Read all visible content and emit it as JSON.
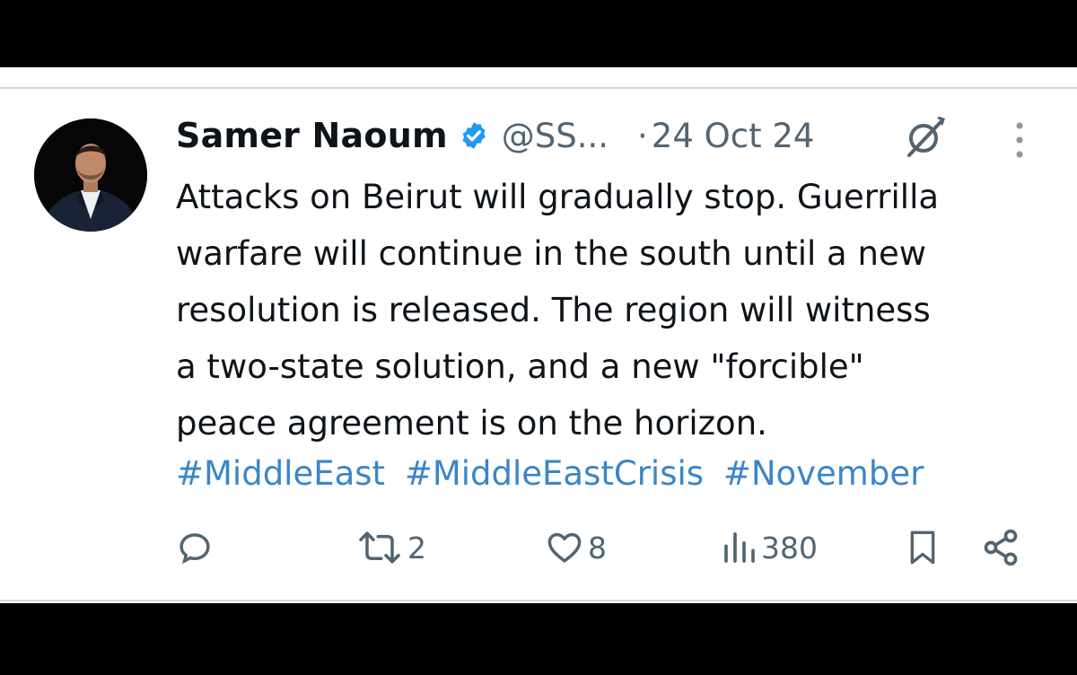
{
  "tweet": {
    "author_name": "Samer Naoum",
    "handle": "@SS...",
    "separator": "·",
    "date": "24 Oct 24",
    "text_lines": [
      "Attacks on Beirut will gradually stop. Guerrilla",
      "warfare will continue in the south until a new",
      "resolution is released. The region will witness",
      "a two-state solution, and a new \"forcible\"",
      "peace agreement is on the horizon."
    ],
    "hashtags": [
      "#MiddleEast",
      "#MiddleEastCrisis",
      "#November"
    ]
  },
  "actions": {
    "reply_count": "",
    "retweet_count": "2",
    "like_count": "8",
    "views_count": "380"
  },
  "icons": {
    "verified": "verified-badge-icon",
    "grok": "grok-icon",
    "more": "more-options-icon",
    "reply": "reply-icon",
    "retweet": "retweet-icon",
    "like": "like-heart-icon",
    "views": "views-chart-icon",
    "bookmark": "bookmark-icon",
    "share": "share-icon"
  },
  "colors": {
    "text": "#0f1419",
    "secondary": "#536471",
    "link": "#3a86c8",
    "verified": "#1d9bf0"
  }
}
